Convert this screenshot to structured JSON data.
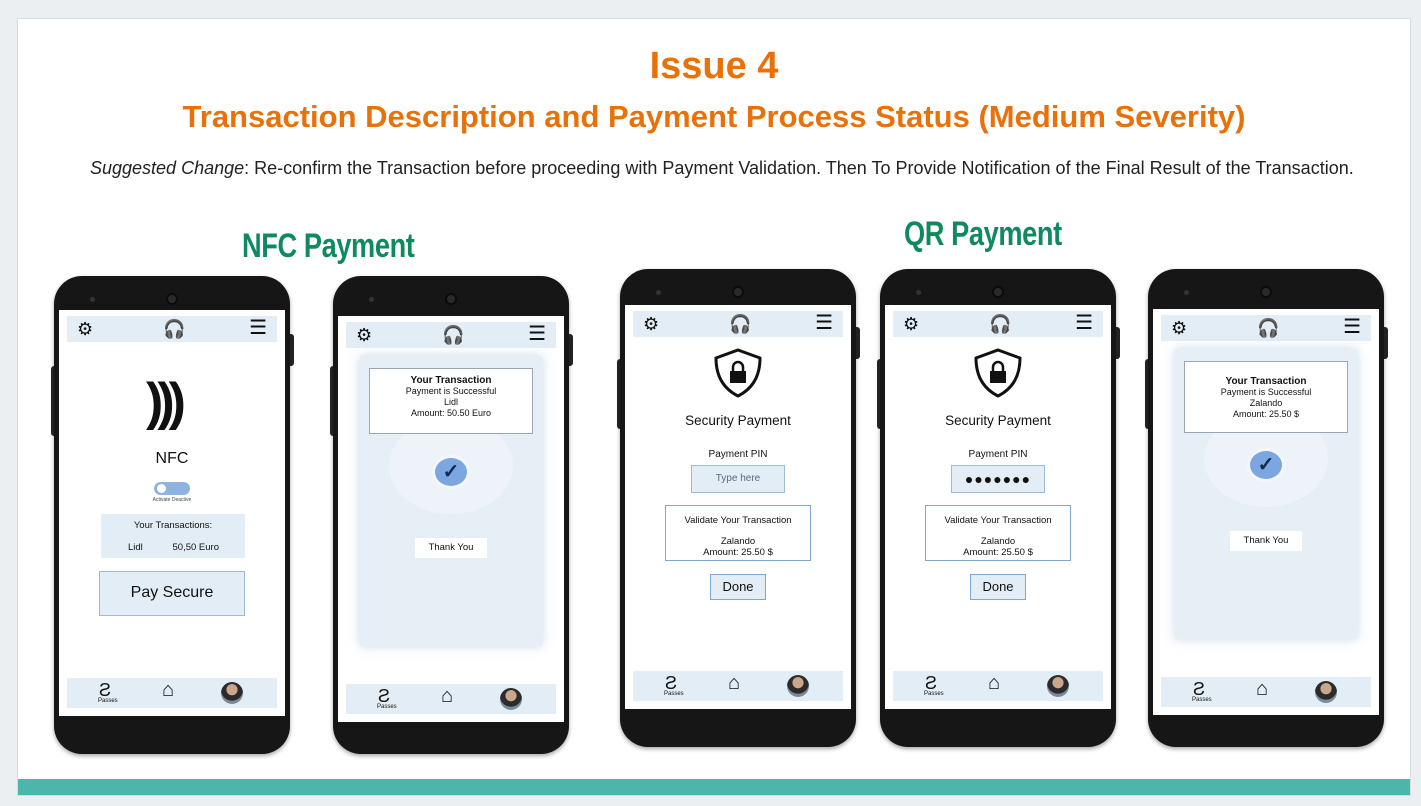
{
  "slide": {
    "title": "Issue 4",
    "subtitle": "Transaction Description and Payment Process Status (Medium Severity)",
    "desc_em": "Suggested Change",
    "desc_rest": ": Re-confirm the Transaction before proceeding with Payment Validation. Then To Provide Notification of the Final Result of the Transaction.",
    "nfc_heading": "NFC Payment",
    "qr_heading": "QR Payment",
    "accent_color": "#e8710a",
    "heading_color": "#0f8a5f",
    "bar_color": "#4db6ac"
  },
  "phone_ui": {
    "icons": [
      "gear-icon",
      "headset-icon",
      "menu-icon",
      "ticket-icon",
      "home-icon",
      "avatar"
    ],
    "nav_passes_label": "Passes"
  },
  "phone1": {
    "nfc_label": "NFC",
    "toggle_caption": "Activate Deactive",
    "transactions_header": "Your Transactions:",
    "merchant": "Lidl",
    "amount": "50,50 Euro",
    "pay_button": "Pay Secure"
  },
  "phone2": {
    "title": "Your Transaction",
    "status": "Payment is Successful",
    "merchant": "Lidl",
    "amount": "Amount: 50.50 Euro",
    "thanks": "Thank You"
  },
  "phone3": {
    "title": "Security Payment",
    "pin_label": "Payment PIN",
    "pin_placeholder": "Type here",
    "validate_title": "Validate Your Transaction",
    "merchant": "Zalando",
    "amount": "Amount: 25.50 $",
    "done": "Done"
  },
  "phone4": {
    "title": "Security Payment",
    "pin_label": "Payment PIN",
    "pin_value": "●●●●●●●",
    "validate_title": "Validate Your Transaction",
    "merchant": "Zalando",
    "amount": "Amount: 25.50 $",
    "done": "Done"
  },
  "phone5": {
    "title": "Your Transaction",
    "status": "Payment is Successful",
    "merchant": "Zalando",
    "amount": "Amount: 25.50 $",
    "thanks": "Thank You"
  }
}
